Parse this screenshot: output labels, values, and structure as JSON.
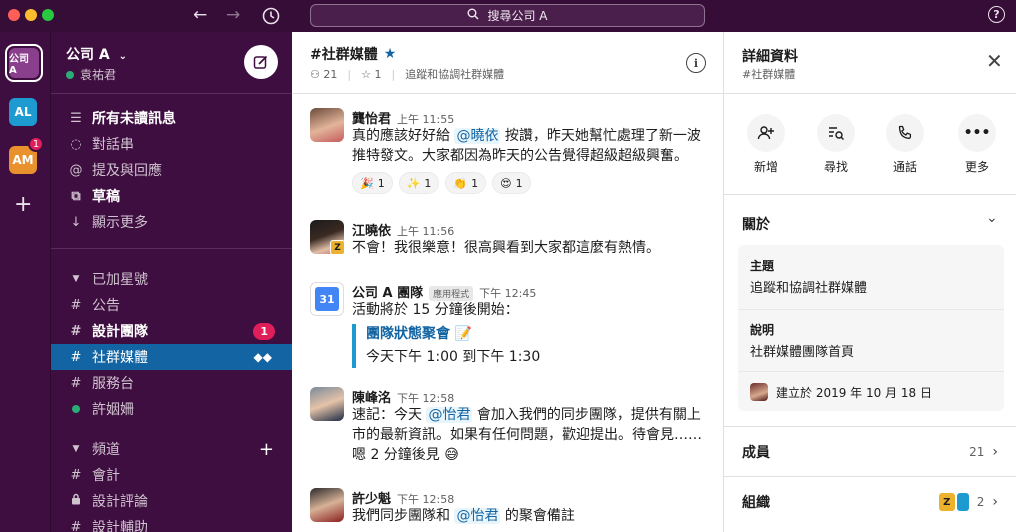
{
  "titlebar": {
    "search_placeholder": "搜尋公司 A",
    "help_label": "?"
  },
  "rail": {
    "active_workspace": "公司 A",
    "workspaces": [
      "AL",
      "AM"
    ],
    "am_badge": "1"
  },
  "sidebar": {
    "workspace_name": "公司 A",
    "user_name": "袁祐君",
    "nav": [
      {
        "label": "所有未讀訊息"
      },
      {
        "label": "對話串"
      },
      {
        "label": "提及與回應"
      },
      {
        "label": "草稿"
      },
      {
        "label": "顯示更多"
      }
    ],
    "starred": {
      "header": "已加星號",
      "items": [
        {
          "label": "公告"
        },
        {
          "label": "設計團隊",
          "badge": "1"
        },
        {
          "label": "社群媒體"
        },
        {
          "label": "服務台"
        },
        {
          "label": "許姻姍"
        }
      ]
    },
    "channels": {
      "header": "頻道",
      "items": [
        {
          "label": "會計"
        },
        {
          "label": "設計評論"
        },
        {
          "label": "設計輔助"
        }
      ]
    }
  },
  "channel": {
    "title": "#社群媒體",
    "member_count": "21",
    "pinned_count": "1",
    "topic": "追蹤和協調社群媒體",
    "messages": [
      {
        "name": "龔怡君",
        "time": "上午 11:55",
        "text_parts": [
          "真的應該好好給 ",
          "@曉依",
          " 按讚，昨天她幫忙處理了新一波推特發文。大家都因為昨天的公告覺得超級超級興奮。"
        ],
        "reactions": [
          {
            "emoji": "🎉",
            "count": "1"
          },
          {
            "emoji": "✨",
            "count": "1"
          },
          {
            "emoji": "👏",
            "count": "1"
          },
          {
            "emoji": "😍",
            "count": "1"
          }
        ]
      },
      {
        "name": "江曉依",
        "time": "上午 11:56",
        "text": "不會！我很樂意！很高興看到大家都這麼有熱情。"
      },
      {
        "name": "公司 A 團隊",
        "app_tag": "應用程式",
        "time": "下午 12:45",
        "calendar_num": "31",
        "text": "活動將於 15 分鐘後開始：",
        "event_title": "團隊狀態聚會 📝",
        "event_time": "今天下午 1:00 到下午 1:30"
      },
      {
        "name": "陳峰洺",
        "time": "下午 12:58",
        "text_parts": [
          "速記：今天 ",
          "@怡君",
          " 會加入我們的同步團隊，提供有關上市的最新資訊。如果有任何問題，歡迎提出。待會見……嗯 2 分鐘後見 😅"
        ]
      },
      {
        "name": "許少魁",
        "time": "下午 12:58",
        "text_parts": [
          "我們同步團隊和 ",
          "@怡君",
          " 的聚會備註"
        ]
      }
    ]
  },
  "details": {
    "title": "詳細資料",
    "subtitle": "#社群媒體",
    "actions": [
      {
        "label": "新增",
        "icon": "add-person-icon"
      },
      {
        "label": "尋找",
        "icon": "find-icon"
      },
      {
        "label": "通話",
        "icon": "phone-icon"
      },
      {
        "label": "更多",
        "icon": "more-icon"
      }
    ],
    "about": {
      "header": "關於",
      "topic_label": "主題",
      "topic_value": "追蹤和協調社群媒體",
      "desc_label": "說明",
      "desc_value": "社群媒體團隊首頁",
      "created": "建立於 2019 年 10 月 18 日"
    },
    "members": {
      "label": "成員",
      "count": "21"
    },
    "orgs": {
      "label": "組織",
      "count": "2"
    }
  }
}
